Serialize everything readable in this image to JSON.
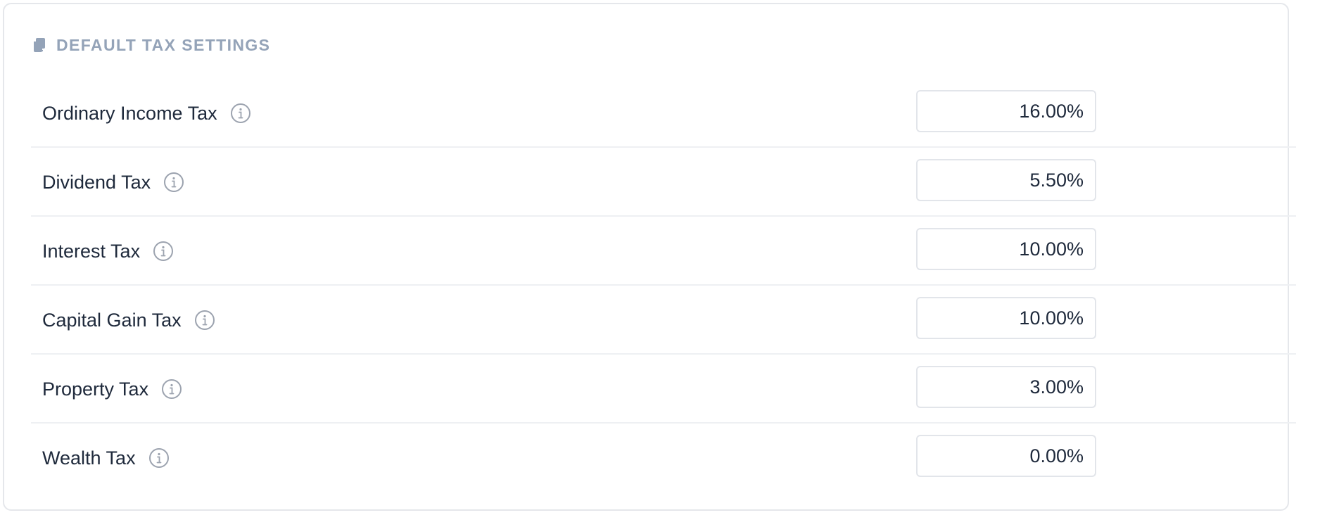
{
  "header": {
    "icon": "documents-icon",
    "title": "DEFAULT TAX SETTINGS"
  },
  "colors": {
    "header_text": "#94a3b8",
    "label_text": "#1e293b",
    "border": "#e5e7eb",
    "info_icon": "#9ca3af"
  },
  "taxes": [
    {
      "label": "Ordinary Income Tax",
      "value": "16.00%",
      "info_icon": "info-icon"
    },
    {
      "label": "Dividend Tax",
      "value": "5.50%",
      "info_icon": "info-icon"
    },
    {
      "label": "Interest Tax",
      "value": "10.00%",
      "info_icon": "info-icon"
    },
    {
      "label": "Capital Gain Tax",
      "value": "10.00%",
      "info_icon": "info-icon"
    },
    {
      "label": "Property Tax",
      "value": "3.00%",
      "info_icon": "info-icon"
    },
    {
      "label": "Wealth Tax",
      "value": "0.00%",
      "info_icon": "info-icon"
    }
  ]
}
